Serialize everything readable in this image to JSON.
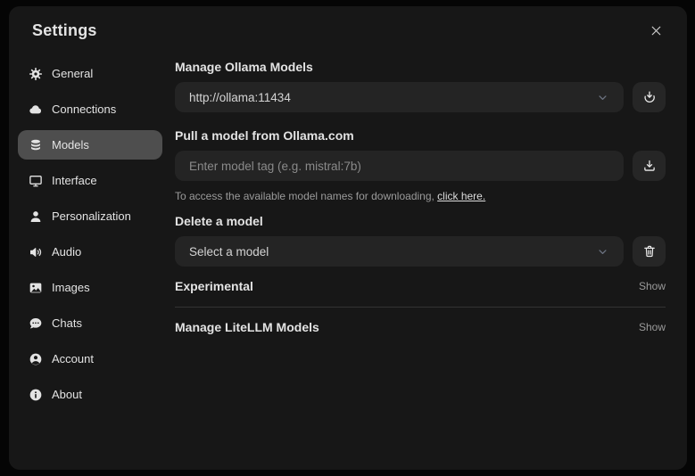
{
  "dialog": {
    "title": "Settings",
    "close_icon": "x-icon"
  },
  "sidebar": {
    "items": [
      {
        "label": "General",
        "icon": "gear-icon",
        "selected": false
      },
      {
        "label": "Connections",
        "icon": "cloud-icon",
        "selected": false
      },
      {
        "label": "Models",
        "icon": "database-icon",
        "selected": true
      },
      {
        "label": "Interface",
        "icon": "monitor-icon",
        "selected": false
      },
      {
        "label": "Personalization",
        "icon": "user-icon",
        "selected": false
      },
      {
        "label": "Audio",
        "icon": "speaker-icon",
        "selected": false
      },
      {
        "label": "Images",
        "icon": "photo-icon",
        "selected": false
      },
      {
        "label": "Chats",
        "icon": "chat-bubble-icon",
        "selected": false
      },
      {
        "label": "Account",
        "icon": "user-circle-icon",
        "selected": false
      },
      {
        "label": "About",
        "icon": "info-icon",
        "selected": false
      }
    ]
  },
  "content": {
    "manage_ollama": {
      "heading": "Manage Ollama Models",
      "url_select_value": "http://ollama:11434",
      "action_icon": "download-icon"
    },
    "pull_model": {
      "heading": "Pull a model from Ollama.com",
      "input_value": "",
      "input_placeholder": "Enter model tag (e.g. mistral:7b)",
      "action_icon": "download-tray-icon",
      "helper_prefix": "To access the available model names for downloading, ",
      "helper_link": "click here."
    },
    "delete_model": {
      "heading": "Delete a model",
      "select_value": "Select a model",
      "action_icon": "trash-icon"
    },
    "experimental": {
      "heading": "Experimental",
      "toggle_label": "Show"
    },
    "litellm": {
      "heading": "Manage LiteLLM Models",
      "toggle_label": "Show"
    }
  },
  "colors": {
    "page_bg": "#050505",
    "dialog_bg": "#171717",
    "field_bg": "#242424",
    "button_bg": "#262626",
    "active_item_bg": "#4e4e4e",
    "text_primary": "#e3e3e3",
    "text_muted": "#9b9b9b",
    "divider": "#333333"
  }
}
